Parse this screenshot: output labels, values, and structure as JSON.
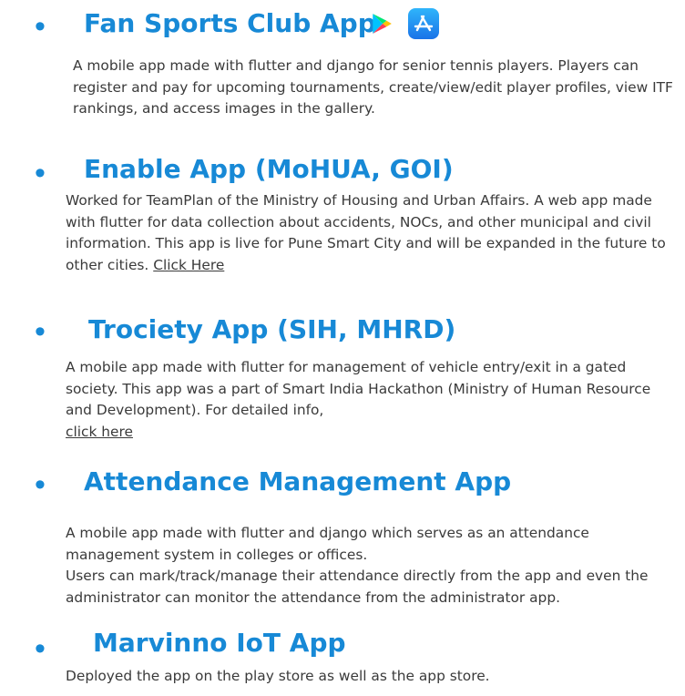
{
  "projects": [
    {
      "title": "Fan Sports Club App",
      "description": "A mobile app made with flutter and django for senior tennis players. Players can register and pay for upcoming tournaments, create/view/edit player profiles, view ITF rankings, and access images in the gallery.",
      "icons": [
        "google-play-icon",
        "app-store-icon"
      ]
    },
    {
      "title": "Enable App (MoHUA, GOI)",
      "description": "Worked for TeamPlan of the Ministry of Housing and Urban Affairs. A web app made with flutter for data collection about accidents, NOCs, and other municipal and civil information. This app is live for Pune Smart City and will be expanded in the future to other cities.",
      "link_text": "Click Here"
    },
    {
      "title": "Trociety App (SIH, MHRD)",
      "description": "A mobile app made with flutter for management of vehicle entry/exit in a gated society. This app was a part of Smart India Hackathon (Ministry of Human Resource and Development). For detailed info,",
      "link_text": "click here"
    },
    {
      "title": "Attendance Management App",
      "description_line1": "A mobile app made with flutter and django which serves as an attendance management system in colleges or offices.",
      "description_line2": "Users can mark/track/manage their attendance directly from the app and even the administrator can monitor the attendance from the administrator app."
    },
    {
      "title": "Marvinno IoT App",
      "description": "Deployed the app on the play store as well as the app store."
    }
  ],
  "colors": {
    "heading": "#1789d6",
    "body_text": "#3a3a3a"
  }
}
